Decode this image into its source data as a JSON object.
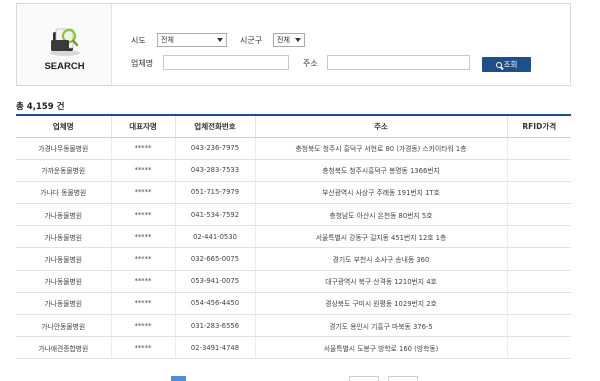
{
  "search": {
    "logo_label": "SEARCH",
    "sido_label": "시도",
    "sido_value": "전체",
    "sigungu_label": "시군구",
    "sigungu_value": "전체",
    "name_label": "업체명",
    "name_value": "",
    "address_label": "주소",
    "address_value": "",
    "button_label": "조회"
  },
  "total_text": "총 4,159 건",
  "table": {
    "headers": [
      "업체명",
      "대표자명",
      "업체전화번호",
      "주소",
      "RFID가격"
    ],
    "rows": [
      [
        "가경나무동물병원",
        "*****",
        "043-236-7975",
        "충청북도 청주시 흥덕구 서현로 80 (가경동) 스카이타워 1층",
        ""
      ],
      [
        "가까운동물병원",
        "*****",
        "043-283-7533",
        "충청북도 청주시흥덕구 봉명동 1366번지",
        ""
      ],
      [
        "가나다 동물병원",
        "*****",
        "051-715-7979",
        "부산광역시 사상구 주례동 191번지 1T호",
        ""
      ],
      [
        "가나동물병원",
        "*****",
        "041-534-7592",
        "충청남도 아산시 온천동 80번지 5호",
        ""
      ],
      [
        "가나동물병원",
        "*****",
        "02-441-0530",
        "서울특별시 강동구 길지동 451번지 12호 1층",
        ""
      ],
      [
        "가나동물병원",
        "*****",
        "032-665-0075",
        "경기도 부천시 소사구 송내동 360",
        ""
      ],
      [
        "가나동물병원",
        "*****",
        "053-941-0075",
        "대구광역시 북구 산격동 1210번지 4호",
        ""
      ],
      [
        "가나동물병원",
        "*****",
        "054-456-4450",
        "경상북도 구미시 원평동 1029번지 2호",
        ""
      ],
      [
        "가나안동물병원",
        "*****",
        "031-283-6556",
        "경기도 용인시 기흥구 마북동 376-5",
        ""
      ],
      [
        "가나애견종합병원",
        "*****",
        "02-3491-4748",
        "서울특별시 도봉구 방학로 160 (방학동)",
        ""
      ]
    ]
  }
}
